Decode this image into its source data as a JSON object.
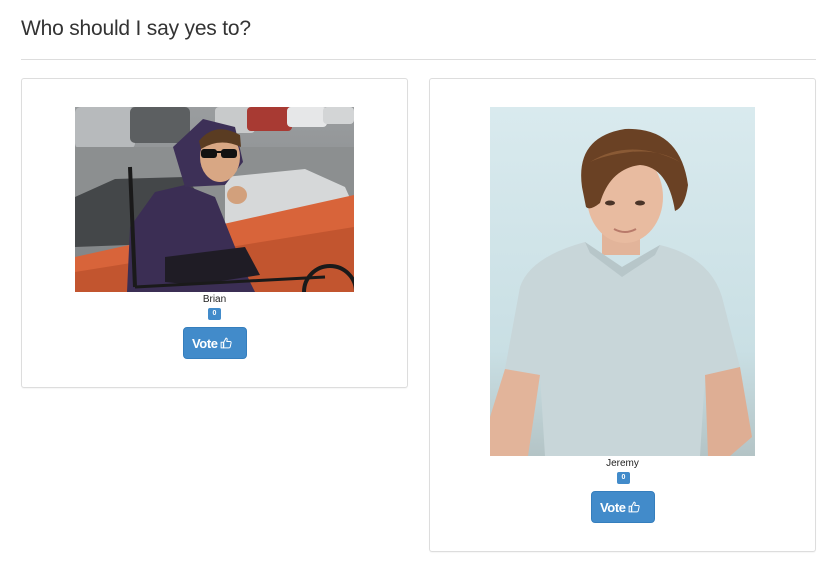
{
  "header": {
    "title": "Who should I say yes to?"
  },
  "candidates": [
    {
      "name": "Brian",
      "votes": "0",
      "vote_label": "Vote",
      "photo_description_icon": "photo-brian"
    },
    {
      "name": "Jeremy",
      "votes": "0",
      "vote_label": "Vote",
      "photo_description_icon": "photo-jeremy"
    }
  ],
  "colors": {
    "primary": "#428bca",
    "primary_border": "#357ebd",
    "divider": "#dddddd",
    "text": "#333333"
  },
  "icons": {
    "vote": "thumbs-up-icon"
  }
}
